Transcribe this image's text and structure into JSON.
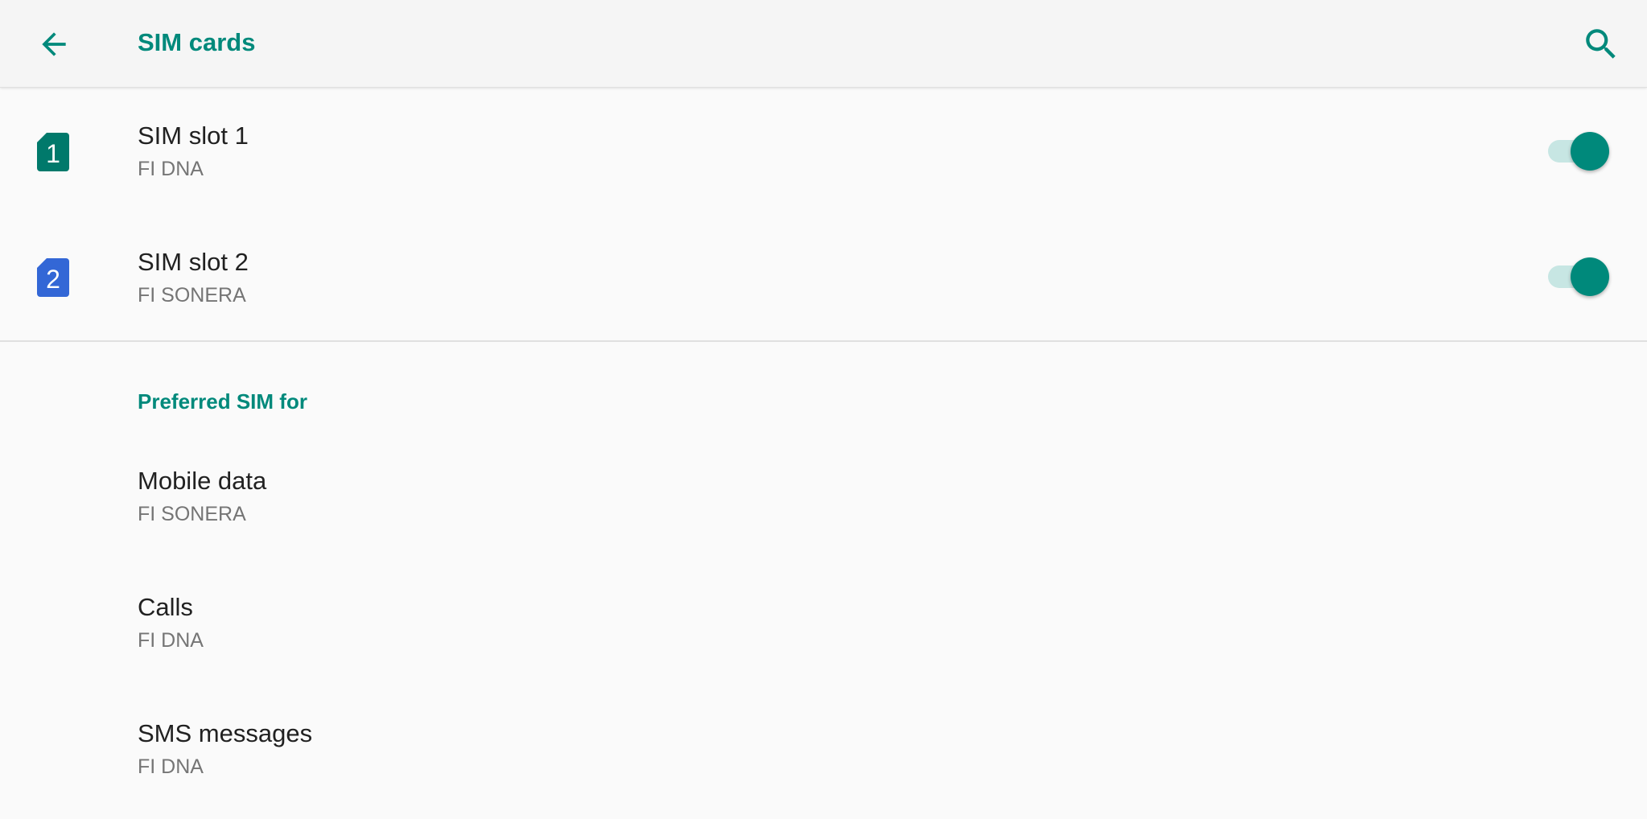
{
  "colors": {
    "accent": "#00897b",
    "sim1_icon": "#00796b",
    "sim2_icon": "#3367d6",
    "toggle_track": "#80cbc4",
    "toggle_thumb": "#00897b"
  },
  "toolbar": {
    "title": "SIM cards",
    "back_icon": "arrow-back-icon",
    "search_icon": "search-icon"
  },
  "sim_slots": [
    {
      "title": "SIM slot 1",
      "carrier": "FI DNA",
      "number": "1",
      "enabled": true
    },
    {
      "title": "SIM slot 2",
      "carrier": "FI SONERA",
      "number": "2",
      "enabled": true
    }
  ],
  "preferred": {
    "header": "Preferred SIM for",
    "items": [
      {
        "title": "Mobile data",
        "value": "FI SONERA"
      },
      {
        "title": "Calls",
        "value": "FI DNA"
      },
      {
        "title": "SMS messages",
        "value": "FI DNA"
      }
    ]
  }
}
